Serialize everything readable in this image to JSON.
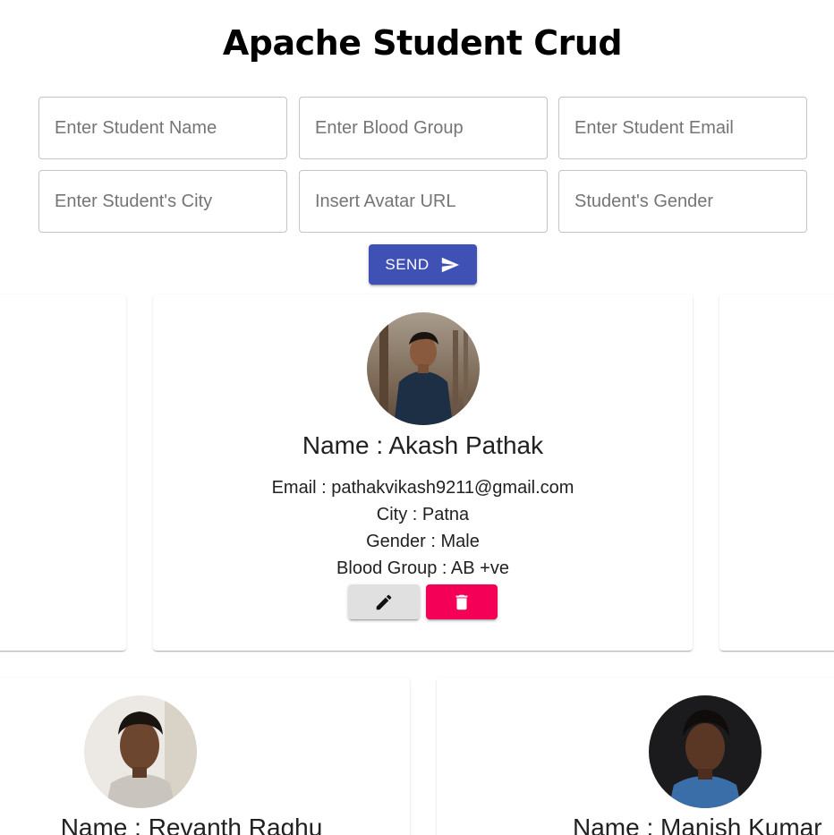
{
  "app": {
    "title": "Apache Student Crud"
  },
  "form": {
    "name_placeholder": "Enter Student Name",
    "blood_group_placeholder": "Enter Blood Group",
    "email_placeholder": "Enter Student Email",
    "city_placeholder": "Enter Student's City",
    "avatar_placeholder": "Insert Avatar URL",
    "gender_placeholder": "Student's Gender",
    "send_label": "SEND",
    "send_icon": "send-icon"
  },
  "students": [
    {
      "name": "Name : Akash Pathak",
      "email": "Email : pathakvikash9211@gmail.com",
      "city": "City : Patna",
      "gender": "Gender : Male",
      "blood_group": "Blood Group : AB +ve",
      "edit_icon": "pencil-icon",
      "delete_icon": "trash-icon"
    },
    {
      "name": "Name : Revanth Raghu"
    },
    {
      "name": "Name : Manish Kumar"
    }
  ],
  "colors": {
    "primary": "#3f51b5",
    "secondary": "#f50057",
    "edit_button": "#e0e0e0",
    "input_border": "#c4c4c4"
  }
}
